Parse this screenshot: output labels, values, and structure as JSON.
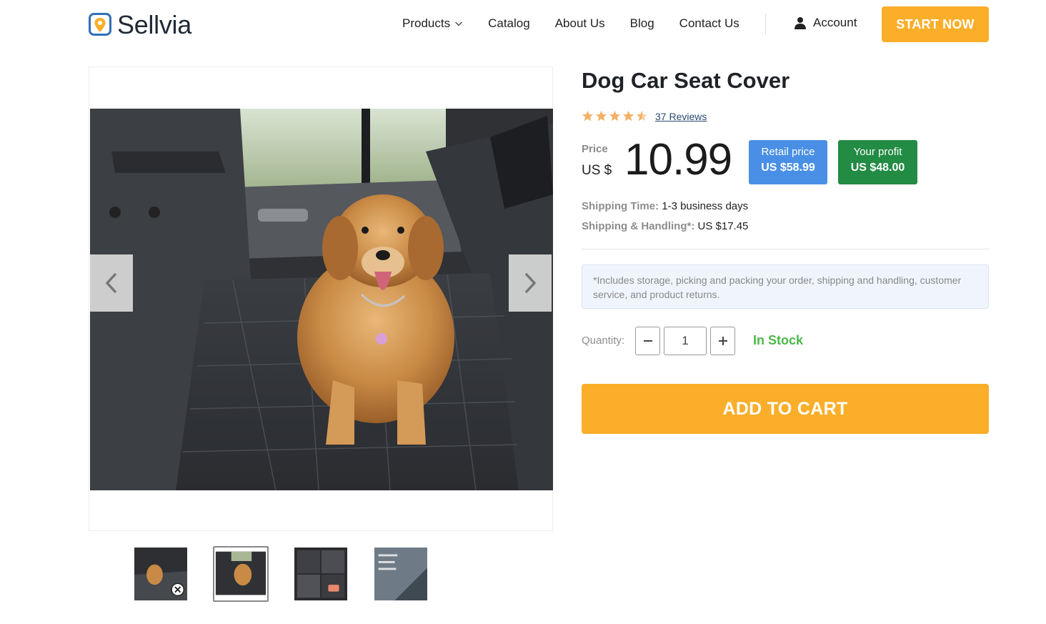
{
  "header": {
    "logo_text": "Sellvia",
    "nav": [
      {
        "label": "Products",
        "has_dropdown": true
      },
      {
        "label": "Catalog"
      },
      {
        "label": "About Us"
      },
      {
        "label": "Blog"
      },
      {
        "label": "Contact Us"
      }
    ],
    "account_label": "Account",
    "cta_label": "START NOW"
  },
  "gallery": {
    "prev_icon": "chevron-left-icon",
    "next_icon": "chevron-right-icon",
    "thumbnail_count": 4,
    "active_thumbnail": 2
  },
  "product": {
    "title": "Dog Car Seat Cover",
    "rating": 4.5,
    "reviews_label": "37 Reviews",
    "price_label": "Price",
    "price_currency": "US $",
    "price_value": "10.99",
    "retail": {
      "label": "Retail price",
      "value": "US $58.99"
    },
    "profit": {
      "label": "Your profit",
      "value": "US $48.00"
    },
    "shipping_time": {
      "label": "Shipping Time:",
      "value": "1-3 business days"
    },
    "shipping_handling": {
      "label": "Shipping & Handling*:",
      "value": "US $17.45"
    },
    "note": "*Includes storage, picking and packing your order, shipping and handling, customer service, and product returns.",
    "quantity_label": "Quantity:",
    "quantity_value": "1",
    "stock_status": "In Stock",
    "add_to_cart_label": "ADD TO CART"
  },
  "colors": {
    "accent_orange": "#fbae29",
    "retail_blue": "#4a8fe6",
    "profit_green": "#228b44",
    "stock_green": "#4cb84a",
    "star_color": "#f4b066"
  }
}
